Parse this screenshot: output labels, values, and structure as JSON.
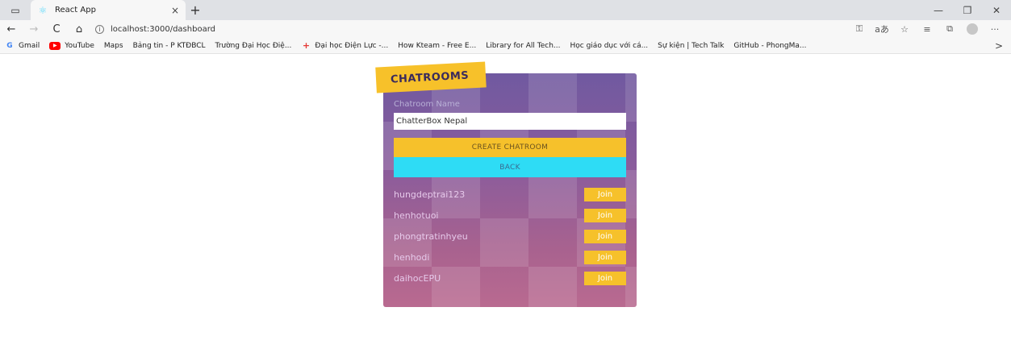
{
  "browser": {
    "tab": {
      "title": "React App",
      "close": "×"
    },
    "new_tab": "+",
    "url": "localhost:3000/dashboard",
    "window_controls": {
      "minimize": "—",
      "restore": "❐",
      "close": "✕"
    },
    "nav": {
      "back": "←",
      "forward": "→",
      "refresh": "C",
      "home": "⌂"
    },
    "bookmarks": [
      {
        "label": "Gmail",
        "icon": "gmail-icon"
      },
      {
        "label": "YouTube",
        "icon": "youtube-icon"
      },
      {
        "label": "Maps",
        "icon": "page-icon"
      },
      {
        "label": "Bảng tin - P KTĐBCL",
        "icon": "page-icon"
      },
      {
        "label": "Trường Đại Học Điệ...",
        "icon": "page-icon"
      },
      {
        "label": "Đại học Điện Lực -...",
        "icon": "cross-icon"
      },
      {
        "label": "How Kteam - Free E...",
        "icon": "page-icon"
      },
      {
        "label": "Library for All Tech...",
        "icon": "page-icon"
      },
      {
        "label": "Học giáo dục với cá...",
        "icon": "page-icon"
      },
      {
        "label": "Sự kiện | Tech Talk",
        "icon": "page-icon"
      },
      {
        "label": "GitHub - PhongMa...",
        "icon": "page-icon"
      }
    ],
    "bookmarks_more": ">"
  },
  "card": {
    "heading": "CHATROOMS",
    "input_label": "Chatroom Name",
    "input_value": "ChatterBox Nepal",
    "create_label": "CREATE CHATROOM",
    "back_label": "BACK",
    "join_label": "Join",
    "rooms": [
      "hungdeptrai123",
      "henhotuoi",
      "phongtratinhyeu",
      "henhodi",
      "daihocEPU"
    ]
  },
  "colors": {
    "accent_yellow": "#f6c12b",
    "accent_cyan": "#2edcf5",
    "card_top": "#7059a0",
    "card_bottom": "#b96a90"
  }
}
